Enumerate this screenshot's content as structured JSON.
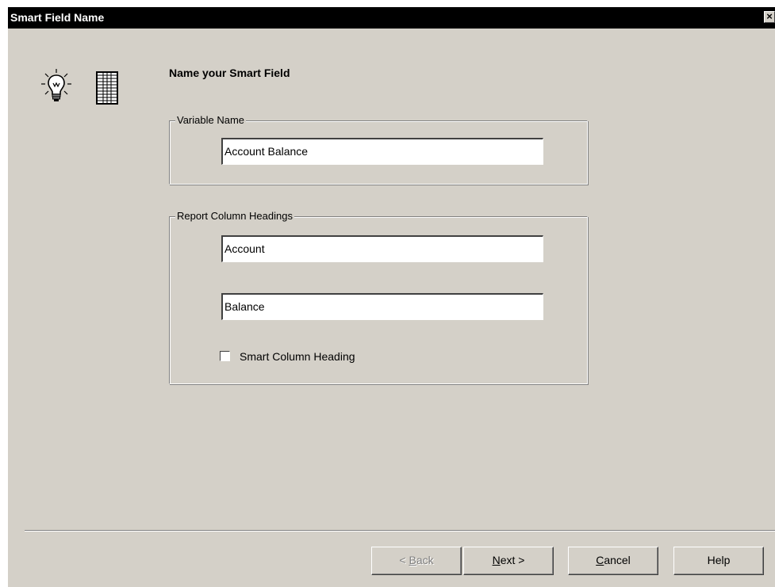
{
  "window": {
    "title": "Smart Field Name",
    "close_glyph": "×"
  },
  "icons": {
    "bulb": "lightbulb-icon",
    "sheet": "spreadsheet-icon"
  },
  "heading": "Name your Smart Field",
  "variable_group": {
    "label": "Variable Name",
    "value": "Account Balance"
  },
  "report_group": {
    "label": "Report Column Headings",
    "heading1": "Account",
    "heading2": "Balance",
    "checkbox_label": "Smart Column Heading",
    "checkbox_checked": false
  },
  "buttons": {
    "back": {
      "prefix": "< ",
      "mnemonic": "B",
      "rest": "ack",
      "disabled": true
    },
    "next": {
      "prefix": "",
      "mnemonic": "N",
      "rest": "ext >",
      "disabled": false
    },
    "cancel": {
      "prefix": "",
      "mnemonic": "C",
      "rest": "ancel",
      "disabled": false
    },
    "help": {
      "label": "Help",
      "disabled": false
    }
  },
  "colors": {
    "face": "#d4d0c8",
    "titlebar": "#000000",
    "field": "#ffffff"
  }
}
